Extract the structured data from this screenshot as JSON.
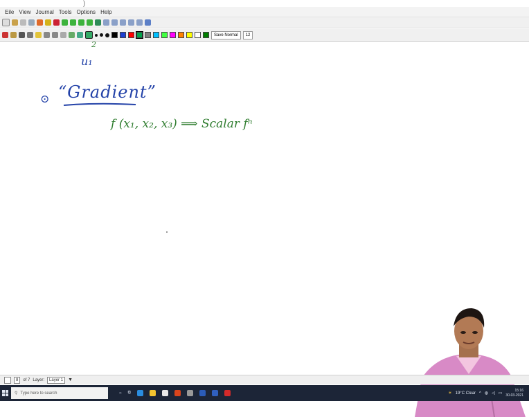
{
  "app": {
    "menu": [
      "Eile",
      "View",
      "Journal",
      "Tools",
      "Options",
      "Help"
    ],
    "pen_style": "Save Normal",
    "pen_size": "12"
  },
  "colors": {
    "ink_blue": "#2342a8",
    "ink_green": "#2f7d2f",
    "pen_palette": [
      "#000000",
      "#1c3fd1",
      "#00a34b",
      "#ff0000",
      "#7f4d00",
      "#b4fc00",
      "#ff00ff",
      "#f09000",
      "#ffff00",
      "#ffffff",
      "#007f00"
    ]
  },
  "canvas": {
    "x1_label": "u₁",
    "bullet": "⊙",
    "title": "“Gradient”",
    "function_line": "f (x₁, x₂, x₃)  ⟹  Scalar fⁿ"
  },
  "status": {
    "page": "8",
    "of_pages": "of 7",
    "layer_label": "Layer:",
    "layer_value": "Layer 1"
  },
  "taskbar": {
    "search_placeholder": "Type here to search",
    "weather": "19°C Clear",
    "time": "15:16",
    "date": "30-03-2021"
  }
}
